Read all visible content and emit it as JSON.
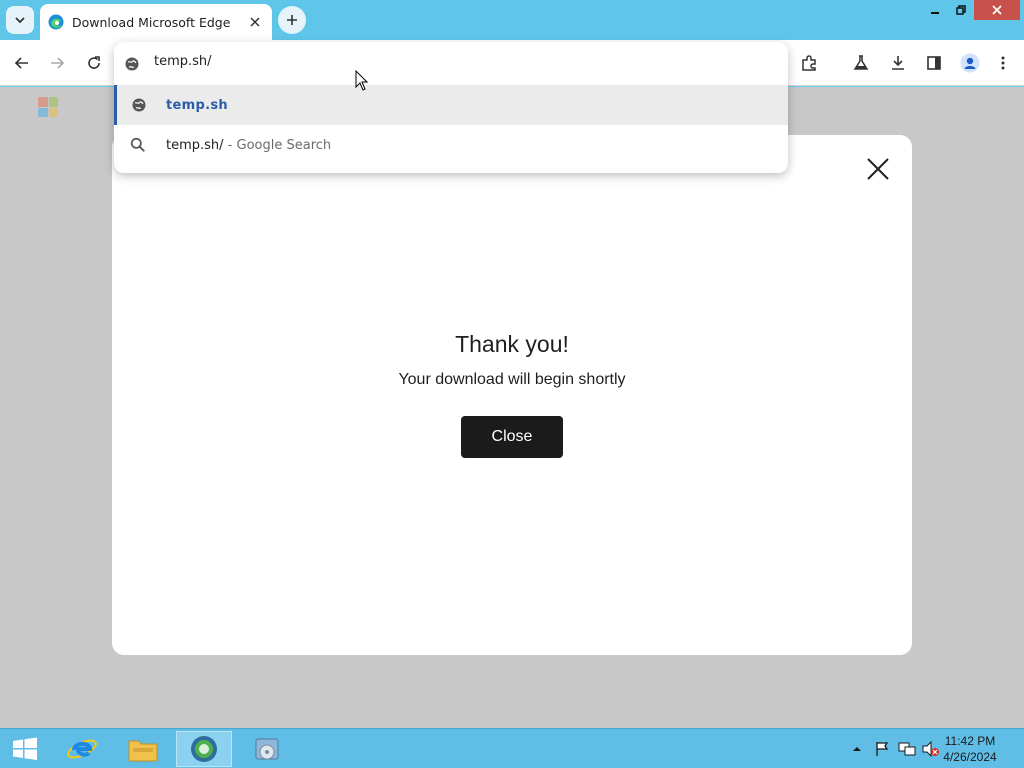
{
  "browser": {
    "tab_title": "Download Microsoft Edge",
    "address_value": "temp.sh/"
  },
  "omnibox": {
    "suggestions": [
      {
        "text": "temp.sh",
        "suffix": "",
        "icon": "globe-icon"
      },
      {
        "text": "temp.sh/",
        "suffix": " - Google Search",
        "icon": "search-icon"
      }
    ]
  },
  "modal": {
    "heading": "Thank you!",
    "message": "Your download will begin shortly",
    "close_label": "Close"
  },
  "taskbar": {
    "time": "11:42 PM",
    "date": "4/26/2024"
  },
  "colors": {
    "titlebar": "#5fc6ea",
    "accent": "#2b5ea8",
    "close_button": "#1b1b1b",
    "window_close": "#c7504a"
  }
}
